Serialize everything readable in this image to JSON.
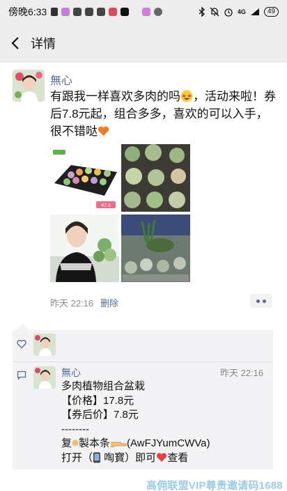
{
  "status_bar": {
    "time": "傍晚6:33",
    "network": "4G",
    "battery": "49"
  },
  "nav": {
    "title": "详情"
  },
  "post": {
    "author": "無心",
    "text_part1": "有跟我一样喜欢多肉的吗",
    "text_part2": "，活动来啦！券后7.8元起，组合多多，喜欢的可以入手，很不错哒",
    "image_badge": "¥7.8",
    "time": "昨天 22:16",
    "delete_label": "删除"
  },
  "comment": {
    "author": "無心",
    "time": "昨天 22:16",
    "line1": "多肉植物组合盆栽",
    "line2": "【价格】17.8元",
    "line3": "【券后价】7.8元",
    "line4": "--------",
    "line5_a": "复",
    "line5_b": "製本条",
    "line5_c": "(AwFJYumCWVa)",
    "line6_a": "打开（",
    "line6_b": " 啕寳）即可",
    "line6_c": "查看"
  },
  "watermark": "高佣联盟VIP尊贵邀请码1688",
  "colors": {
    "link": "#576b95",
    "navbar_bg": "#ededed",
    "panel_bg": "#f3f3f5",
    "heart": "#e64340",
    "watermark": "#9ccbe6"
  }
}
